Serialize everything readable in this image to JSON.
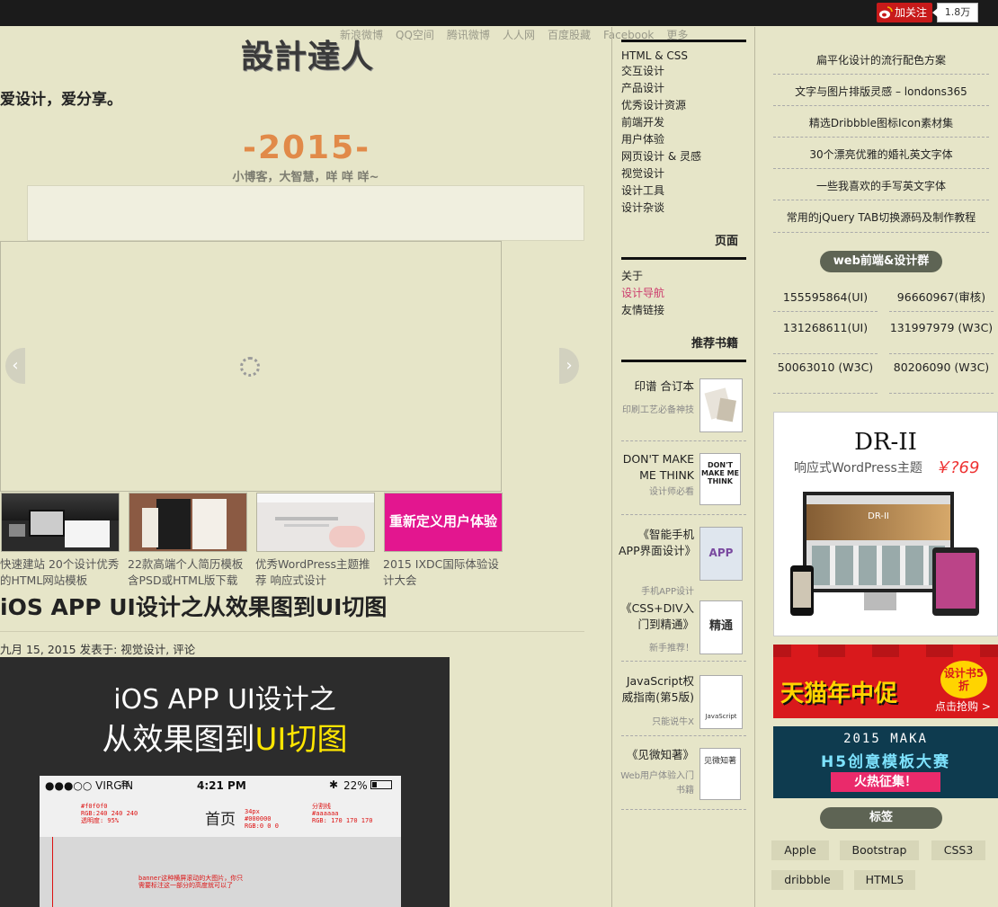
{
  "topbar": {
    "follow_label": "加关注",
    "follow_count": "1.8万"
  },
  "share_links": [
    "新浪微博",
    "QQ空间",
    "腾讯微博",
    "人人网",
    "百度股藏",
    "Facebook",
    "更多"
  ],
  "site": {
    "logo": "設計達人",
    "tagline": "爱设计，爱分享。",
    "year": "-2015-",
    "motto": "小博客，大智慧，咩 咩 咩~"
  },
  "thumbs": [
    {
      "caption": "快速建站 20个设计优秀的HTML网站模板"
    },
    {
      "caption": "22款高端个人简历模板含PSD或HTML版下载"
    },
    {
      "caption": "优秀WordPress主题推荐 响应式设计"
    },
    {
      "caption": "2015 IXDC国际体验设计大会",
      "image_text": "重新定义用户体验"
    }
  ],
  "post": {
    "title": "iOS APP UI设计之从效果图到UI切图",
    "meta": "九月 15, 2015 发表于: 视觉设计, 评论",
    "hero_line1": "iOS APP UI设计之",
    "hero_line2_a": "从效果图到",
    "hero_line2_b": "UI切图",
    "phone": {
      "carrier": "●●●○○ VIRGIN",
      "time": "4:21 PM",
      "battery": "22%",
      "nav_title": "首页",
      "note1": "#f0f0f0\nRGB:240 240 240\n透明度: 95%",
      "note2": "34px\n#000000\nRGB:0 0 0",
      "note3": "分割线\n#aaaaaa\nRGB: 170 170 170",
      "note4": "banner这种横屏滚动的大图片，你只\n需要标注这一部分的高度就可以了"
    }
  },
  "categories": [
    "HTML & CSS",
    "交互设计",
    "产品设计",
    "优秀设计资源",
    "前端开发",
    "用户体验",
    "网页设计 & 灵感",
    "视觉设计",
    "设计工具",
    "设计杂谈"
  ],
  "pages": {
    "heading": "页面",
    "items": [
      "关于",
      "设计导航",
      "友情链接"
    ],
    "accent": "#cc3a6c"
  },
  "books": {
    "heading": "推荐书籍",
    "items": [
      {
        "title": "印谱 合订本",
        "sub": "印刷工艺必备神技",
        "cover": ""
      },
      {
        "title": "DON'T MAKE ME THINK",
        "sub": "设计师必看",
        "cover": "DON'T MAKE ME THINK"
      },
      {
        "title": "《智能手机APP界面设计》",
        "sub": "手机APP设计",
        "cover": "APP"
      },
      {
        "title": "《CSS+DIV入门到精通》",
        "sub": "新手推荐！",
        "cover": "精通"
      },
      {
        "title": "JavaScript权威指南(第5版)",
        "sub": "只能说牛X",
        "cover": "JavaScript"
      },
      {
        "title": "《见微知著》",
        "sub": "Web用户体验入门书籍",
        "cover": "见微知著"
      }
    ]
  },
  "right_links": [
    "扁平化设计的流行配色方案",
    "文字与图片排版灵感 – londons365",
    "精选Dribbble图标Icon素材集",
    "30个漂亮优雅的婚礼英文字体",
    "一些我喜欢的手写英文字体",
    "常用的jQuery TAB切换源码及制作教程"
  ],
  "qq_groups": {
    "heading": "web前端&设计群",
    "items": [
      "155595864(UI)",
      "96660967(审核)",
      "131268611(UI)",
      "131997979 (W3C)",
      "50063010 (W3C)",
      "80206090 (W3C)"
    ]
  },
  "theme_ad": {
    "name": "DR-II",
    "subtitle": "响应式WordPress主题",
    "price": "￥?69",
    "screen_text": "DR-II"
  },
  "tmall_ad": {
    "main": "天猫年中促",
    "badge": "设计书5折",
    "cta": "点击抢购 >"
  },
  "maka_ad": {
    "line1": "2015 MAKA",
    "line2": "H5创意模板大赛",
    "line3": "火热征集！"
  },
  "tags": {
    "heading": "标签",
    "items": [
      "Apple",
      "Bootstrap",
      "CSS3",
      "dribbble",
      "HTML5"
    ]
  },
  "colors": {
    "background": "#e6e5c8",
    "topbar": "#1b1b1b",
    "year": "#e18a49",
    "pill": "#5e6454"
  }
}
